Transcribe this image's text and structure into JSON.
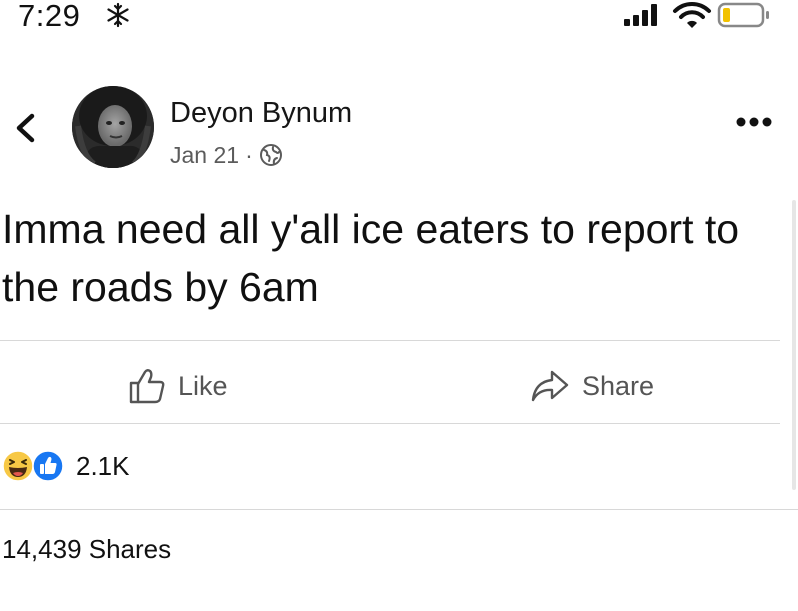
{
  "status_bar": {
    "time": "7:29"
  },
  "post": {
    "author": "Deyon Bynum",
    "date": "Jan 21",
    "separator": "·",
    "text": "Imma need all y'all ice eaters to report to the roads by 6am"
  },
  "actions": {
    "like_label": "Like",
    "share_label": "Share"
  },
  "reactions": {
    "count": "2.1K"
  },
  "shares_text": "14,439 Shares",
  "icons": {
    "status": [
      "snowflake-icon",
      "cellular-signal-icon",
      "wifi-icon",
      "battery-icon"
    ],
    "header": [
      "back-chevron-icon",
      "globe-icon",
      "more-options-icon"
    ],
    "actions": [
      "thumbs-up-outline-icon",
      "share-arrow-icon"
    ],
    "reactions": [
      "haha-reaction-icon",
      "like-reaction-icon"
    ]
  },
  "colors": {
    "like_blue": "#1877f2",
    "haha_yellow": "#f7c845",
    "muted_text": "#5b5b5b",
    "divider": "#d8d8d8"
  }
}
